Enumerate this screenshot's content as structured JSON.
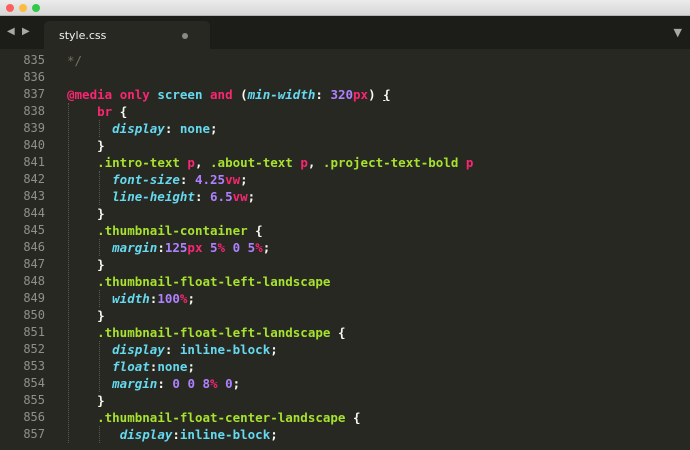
{
  "window": {
    "controls": [
      "close",
      "minimize",
      "zoom"
    ]
  },
  "tabbar": {
    "nav_prev_icon": "◀",
    "nav_next_icon": "▶",
    "tab_title": "style.css",
    "menu_icon": "▼"
  },
  "editor": {
    "line_numbers": [
      "835",
      "836",
      "837",
      "838",
      "839",
      "840",
      "841",
      "842",
      "843",
      "844",
      "845",
      "846",
      "847",
      "848",
      "849",
      "850",
      "851",
      "852",
      "853",
      "854",
      "855",
      "856",
      "857"
    ],
    "lines": [
      [
        [
          "com",
          "*/"
        ]
      ],
      [],
      [
        [
          "at",
          "@media "
        ],
        [
          "kw",
          "only "
        ],
        [
          "fn",
          "screen "
        ],
        [
          "kw",
          "and "
        ],
        [
          "p",
          "("
        ],
        [
          "prop",
          "min-width"
        ],
        [
          "p",
          ": "
        ],
        [
          "num",
          "320"
        ],
        [
          "unit",
          "px"
        ],
        [
          "p",
          ") "
        ],
        [
          "p",
          "{"
        ]
      ],
      [
        [
          "p",
          "    "
        ],
        [
          "tag",
          "br "
        ],
        [
          "p",
          "{"
        ]
      ],
      [
        [
          "p",
          "      "
        ],
        [
          "prop",
          "display"
        ],
        [
          "p",
          ": "
        ],
        [
          "fn",
          "none"
        ],
        [
          "p",
          ";"
        ]
      ],
      [
        [
          "p",
          "    }"
        ]
      ],
      [
        [
          "p",
          "    "
        ],
        [
          "sel",
          ".intro-text "
        ],
        [
          "tag",
          "p"
        ],
        [
          "p",
          ", "
        ],
        [
          "sel",
          ".about-text "
        ],
        [
          "tag",
          "p"
        ],
        [
          "p",
          ", "
        ],
        [
          "sel",
          ".project-text-bold "
        ],
        [
          "tag",
          "p"
        ]
      ],
      [
        [
          "p",
          "      "
        ],
        [
          "prop",
          "font-size"
        ],
        [
          "p",
          ": "
        ],
        [
          "num",
          "4.25"
        ],
        [
          "unit",
          "vw"
        ],
        [
          "p",
          ";"
        ]
      ],
      [
        [
          "p",
          "      "
        ],
        [
          "prop",
          "line-height"
        ],
        [
          "p",
          ": "
        ],
        [
          "num",
          "6.5"
        ],
        [
          "unit",
          "vw"
        ],
        [
          "p",
          ";"
        ]
      ],
      [
        [
          "p",
          "    }"
        ]
      ],
      [
        [
          "p",
          "    "
        ],
        [
          "sel",
          ".thumbnail-container "
        ],
        [
          "p",
          "{"
        ]
      ],
      [
        [
          "p",
          "      "
        ],
        [
          "prop",
          "margin"
        ],
        [
          "p",
          ":"
        ],
        [
          "num",
          "125"
        ],
        [
          "unit",
          "px "
        ],
        [
          "num",
          "5"
        ],
        [
          "unit",
          "% "
        ],
        [
          "num",
          "0 "
        ],
        [
          "num",
          "5"
        ],
        [
          "unit",
          "%"
        ],
        [
          "p",
          ";"
        ]
      ],
      [
        [
          "p",
          "    }"
        ]
      ],
      [
        [
          "p",
          "    "
        ],
        [
          "sel",
          ".thumbnail-float-left-landscape"
        ]
      ],
      [
        [
          "p",
          "      "
        ],
        [
          "prop",
          "width"
        ],
        [
          "p",
          ":"
        ],
        [
          "num",
          "100"
        ],
        [
          "unit",
          "%"
        ],
        [
          "p",
          ";"
        ]
      ],
      [
        [
          "p",
          "    }"
        ]
      ],
      [
        [
          "p",
          "    "
        ],
        [
          "sel",
          ".thumbnail-float-left-landscape "
        ],
        [
          "p",
          "{"
        ]
      ],
      [
        [
          "p",
          "      "
        ],
        [
          "prop",
          "display"
        ],
        [
          "p",
          ": "
        ],
        [
          "fn",
          "inline-block"
        ],
        [
          "p",
          ";"
        ]
      ],
      [
        [
          "p",
          "      "
        ],
        [
          "prop",
          "float"
        ],
        [
          "p",
          ":"
        ],
        [
          "fn",
          "none"
        ],
        [
          "p",
          ";"
        ]
      ],
      [
        [
          "p",
          "      "
        ],
        [
          "prop",
          "margin"
        ],
        [
          "p",
          ": "
        ],
        [
          "num",
          "0 "
        ],
        [
          "num",
          "0 "
        ],
        [
          "num",
          "8"
        ],
        [
          "unit",
          "% "
        ],
        [
          "num",
          "0"
        ],
        [
          "p",
          ";"
        ]
      ],
      [
        [
          "p",
          "    }"
        ]
      ],
      [
        [
          "p",
          "    "
        ],
        [
          "sel",
          ".thumbnail-float-center-landscape "
        ],
        [
          "p",
          "{"
        ]
      ],
      [
        [
          "p",
          "       "
        ],
        [
          "prop",
          "display"
        ],
        [
          "p",
          ":"
        ],
        [
          "fn",
          "inline-block"
        ],
        [
          "p",
          ";"
        ]
      ]
    ]
  },
  "colors": {
    "background": "#272822",
    "comment": "#75715e",
    "keyword": "#f92672",
    "support": "#66d9ef",
    "number": "#ae81ff",
    "selector": "#a6e22e",
    "text": "#f8f8f2"
  }
}
